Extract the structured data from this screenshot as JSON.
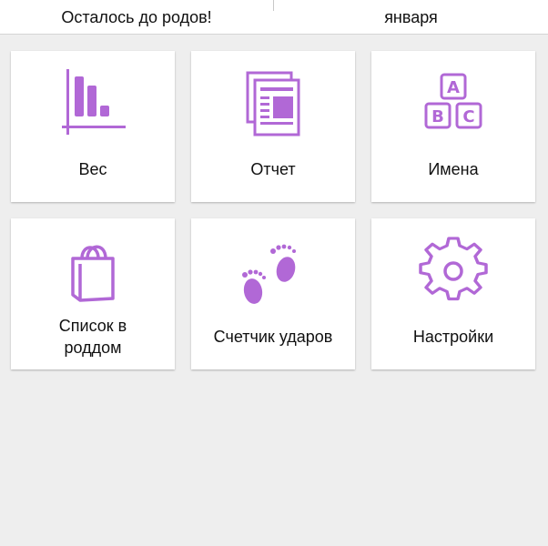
{
  "header": {
    "left_text": "Осталось до родов!",
    "right_text": "января"
  },
  "tiles": [
    {
      "label": "Вес",
      "icon": "bar-chart-icon"
    },
    {
      "label": "Отчет",
      "icon": "report-document-icon"
    },
    {
      "label": "Имена",
      "icon": "abc-blocks-icon"
    },
    {
      "label_line1": "Список в",
      "label_line2": "роддом",
      "icon": "shopping-bag-icon"
    },
    {
      "label": "Счетчик ударов",
      "icon": "baby-footprints-icon"
    },
    {
      "label": "Настройки",
      "icon": "gear-icon"
    }
  ],
  "colors": {
    "accent": "#b168d6",
    "background": "#eeeeee",
    "tile": "#ffffff"
  }
}
